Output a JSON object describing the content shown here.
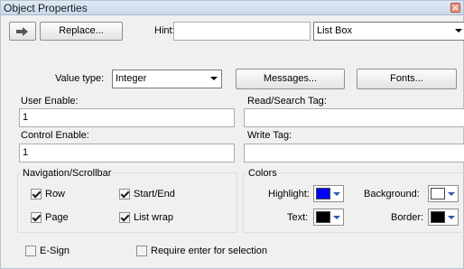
{
  "window": {
    "title": "Object Properties"
  },
  "toolbar": {
    "replace_label": "Replace...",
    "hint_label": "Hint:",
    "hint_value": "",
    "object_type": "List Box"
  },
  "value": {
    "label": "Value type:",
    "selected": "Integer",
    "messages_label": "Messages...",
    "fonts_label": "Fonts..."
  },
  "fields": {
    "user_enable_label": "User Enable:",
    "user_enable_value": "1",
    "read_search_tag_label": "Read/Search Tag:",
    "read_search_tag_value": "",
    "control_enable_label": "Control Enable:",
    "control_enable_value": "1",
    "write_tag_label": "Write Tag:",
    "write_tag_value": ""
  },
  "navigation": {
    "group_label": "Navigation/Scrollbar",
    "row_label": "Row",
    "row_checked": true,
    "start_end_label": "Start/End",
    "start_end_checked": true,
    "page_label": "Page",
    "page_checked": true,
    "list_wrap_label": "List wrap",
    "list_wrap_checked": true
  },
  "colors": {
    "group_label": "Colors",
    "highlight_label": "Highlight:",
    "highlight_color": "#0000ff",
    "background_label": "Background:",
    "background_color": "#ffffff",
    "text_label": "Text:",
    "text_color": "#000000",
    "border_label": "Border:",
    "border_color": "#000000"
  },
  "bottom": {
    "esign_label": "E-Sign",
    "esign_checked": false,
    "require_enter_label": "Require enter for selection",
    "require_enter_checked": false
  }
}
